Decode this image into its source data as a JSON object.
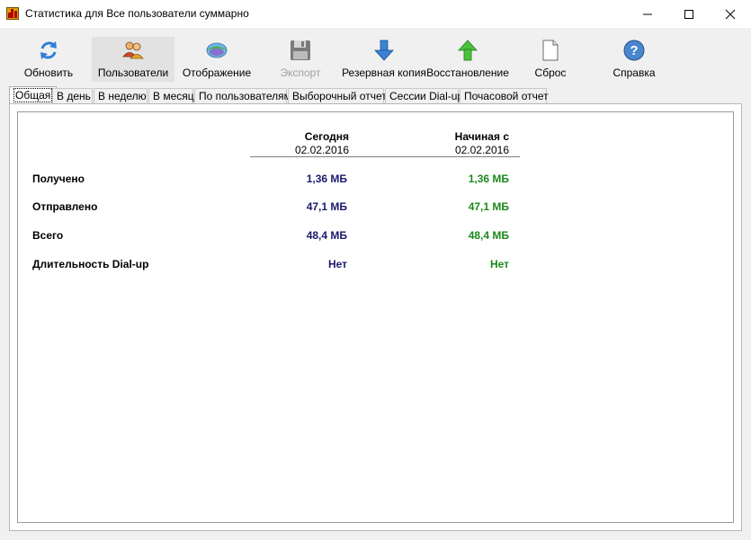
{
  "window": {
    "title": "Статистика для Все пользователи суммарно",
    "minimize_glyph": "—",
    "maximize_glyph": "☐",
    "close_glyph": "✕"
  },
  "toolbar": {
    "items": [
      {
        "label": "Обновить",
        "icon": "refresh-icon"
      },
      {
        "label": "Пользователи",
        "icon": "users-icon",
        "active": true
      },
      {
        "label": "Отображение",
        "icon": "display-icon"
      },
      {
        "label": "Экспорт",
        "icon": "floppy-disk-icon",
        "disabled": true
      },
      {
        "label": "Резервная копия",
        "icon": "arrow-down-icon"
      },
      {
        "label": "Восстановление",
        "icon": "arrow-up-icon"
      },
      {
        "label": "Сброс",
        "icon": "blank-document-icon"
      },
      {
        "label": "Справка",
        "icon": "help-icon"
      }
    ]
  },
  "tabs": [
    {
      "label": "Общая",
      "selected": true
    },
    {
      "label": "В день"
    },
    {
      "label": "В неделю"
    },
    {
      "label": "В месяц"
    },
    {
      "label": "По пользователям"
    },
    {
      "label": "Выборочный отчет"
    },
    {
      "label": "Сессии Dial-up"
    },
    {
      "label": "Почасовой отчет"
    }
  ],
  "summary": {
    "col_today": {
      "title": "Сегодня",
      "date": "02.02.2016"
    },
    "col_since": {
      "title": "Начиная с",
      "date": "02.02.2016"
    },
    "rows": [
      {
        "label": "Получено",
        "today": "1,36 МБ",
        "since": "1,36 МБ"
      },
      {
        "label": "Отправлено",
        "today": "47,1 МБ",
        "since": "47,1 МБ"
      },
      {
        "label": "Всего",
        "today": "48,4 МБ",
        "since": "48,4 МБ"
      },
      {
        "label": "Длительность Dial-up",
        "today": "Нет",
        "since": "Нет"
      }
    ]
  },
  "colors": {
    "today_value": "#1a1a6e",
    "since_value": "#1b8a1b",
    "disabled_text": "#a0a0a0"
  }
}
